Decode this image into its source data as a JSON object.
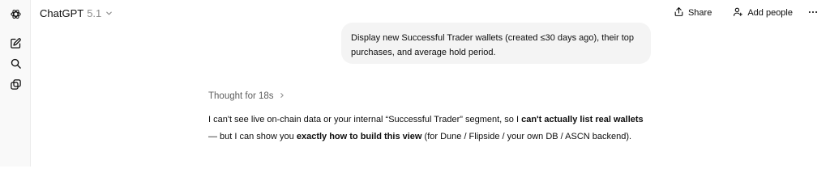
{
  "sidebar": {
    "items": [
      {
        "name": "openai-logo-icon"
      },
      {
        "name": "new-chat-icon"
      },
      {
        "name": "search-icon"
      },
      {
        "name": "library-icon"
      }
    ]
  },
  "header": {
    "model_name": "ChatGPT",
    "model_version": "5.1",
    "share_label": "Share",
    "add_people_label": "Add people"
  },
  "conversation": {
    "user_message": "Display new Successful Trader wallets (created ≤30 days ago), their top purchases, and average hold period.",
    "thought_label": "Thought for 18s",
    "answer": {
      "part1": "I can't see live on-chain data or your internal “Successful Trader” segment, so I ",
      "bold1": "can't actually list real wallets",
      "part2": " — but I can show you ",
      "bold2": "exactly how to build this view",
      "part3": " (for Dune / Flipside / your own DB / ASCN backend)."
    }
  },
  "colors": {
    "sidebar_bg": "#f9f9f9",
    "bubble_bg": "#f4f4f4",
    "muted_text": "#8f8f8f",
    "text": "#0d0d0d"
  }
}
